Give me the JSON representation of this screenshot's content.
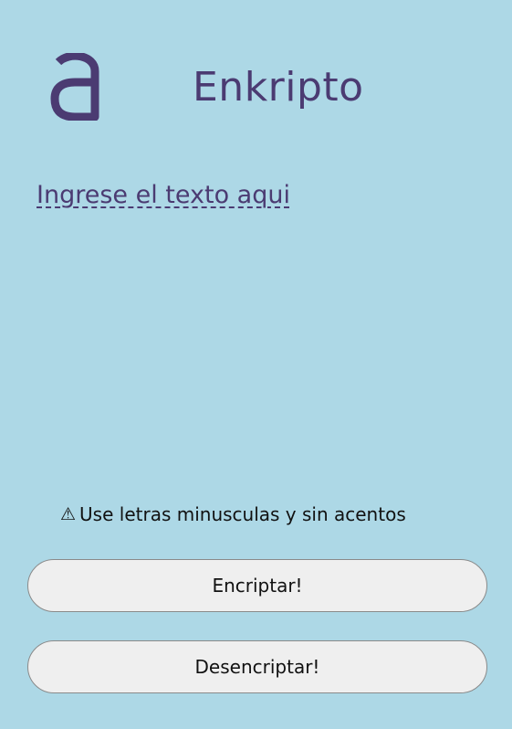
{
  "header": {
    "logo_icon": "stylized-a-logo",
    "title": "Enkripto"
  },
  "input": {
    "placeholder": "Ingrese el texto aqui",
    "value": ""
  },
  "notice": {
    "icon": "warning-triangle-icon",
    "text": "Use letras minusculas y sin acentos"
  },
  "actions": {
    "encrypt_label": "Encriptar!",
    "decrypt_label": "Desencriptar!"
  },
  "colors": {
    "background": "#add8e6",
    "accent": "#4b3b72",
    "button_bg": "#efefef"
  }
}
